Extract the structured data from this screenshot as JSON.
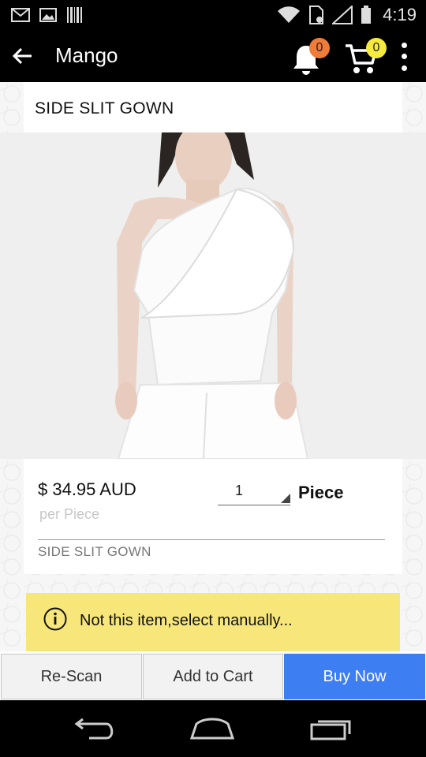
{
  "status_bar": {
    "time": "4:19",
    "icons": [
      "gmail-icon",
      "image-icon",
      "barcode-icon",
      "wifi-icon",
      "sim-icon",
      "signal-icon",
      "battery-icon"
    ]
  },
  "app_bar": {
    "title": "Mango",
    "notifications_count": "0",
    "cart_count": "0"
  },
  "product": {
    "title": "SIDE SLIT GOWN",
    "price": "$ 34.95 AUD",
    "price_unit": "per Piece",
    "quantity": "1",
    "quantity_unit": "Piece",
    "description": "SIDE SLIT GOWN"
  },
  "notice": {
    "text": "Not this item,select manually..."
  },
  "actions": {
    "rescan_label": "Re-Scan",
    "add_to_cart_label": "Add to Cart",
    "buy_now_label": "Buy Now"
  },
  "colors": {
    "accent": "#3d7ef2",
    "notice_bg": "#f7e77a",
    "badge_notification": "#f07c3a",
    "badge_cart": "#f7ea3f"
  }
}
